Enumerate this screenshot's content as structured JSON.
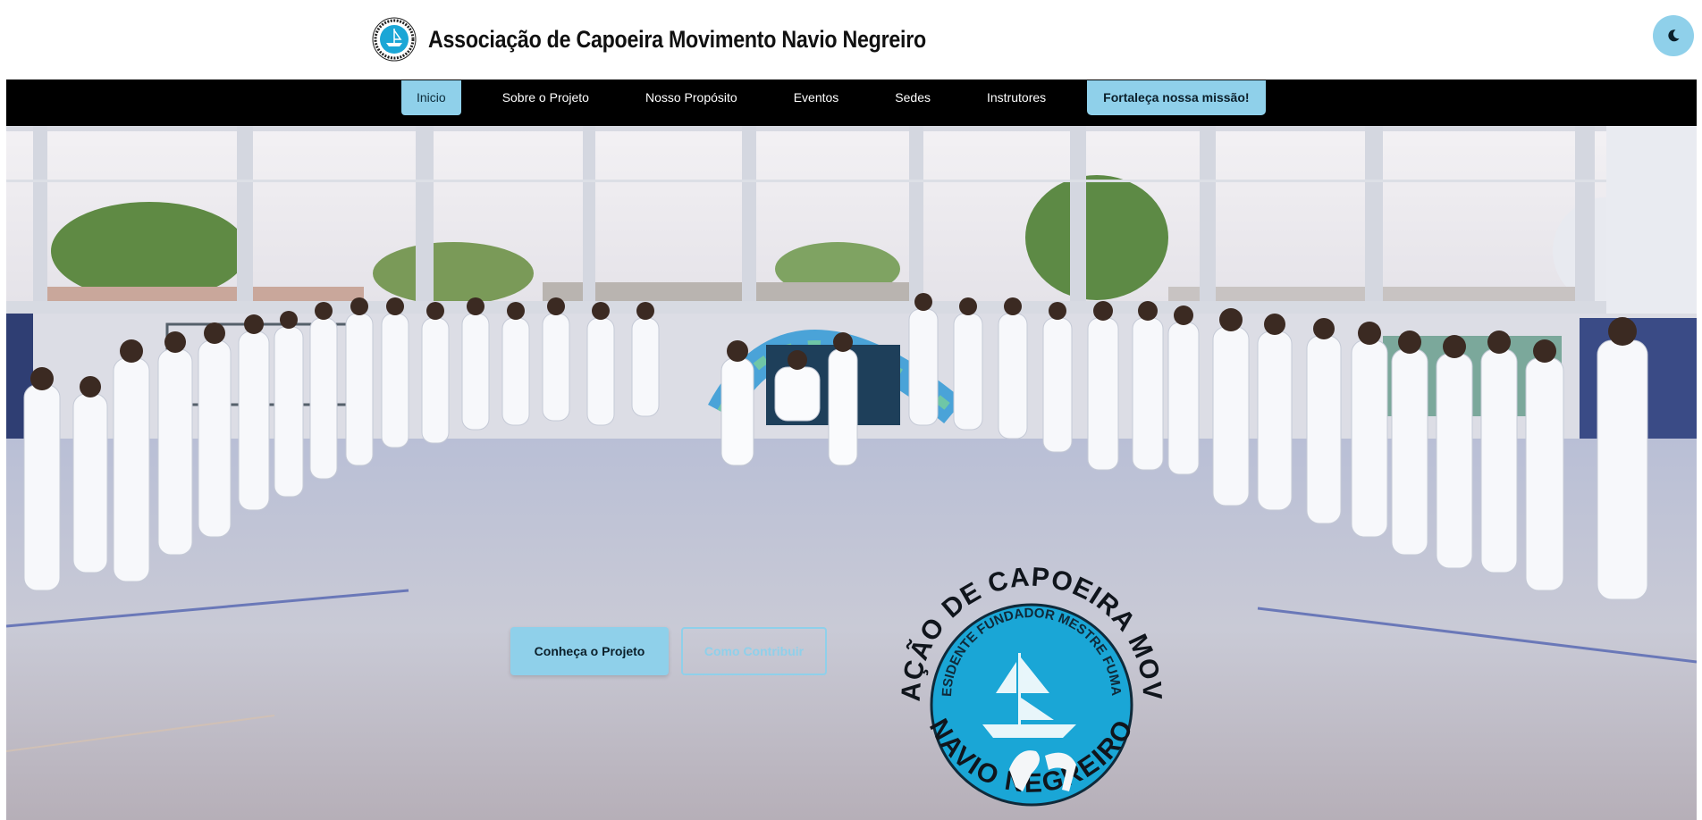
{
  "header": {
    "title": "Associação de Capoeira Movimento Navio Negreiro",
    "logo_icon": "association-logo",
    "theme_toggle_icon": "moon-icon"
  },
  "nav": {
    "items": [
      {
        "label": "Inicio",
        "active": true
      },
      {
        "label": "Sobre o Projeto"
      },
      {
        "label": "Nosso Propósito"
      },
      {
        "label": "Eventos"
      },
      {
        "label": "Sedes"
      },
      {
        "label": "Instrutores"
      }
    ],
    "cta_label": "Fortaleça nossa missão!"
  },
  "hero": {
    "primary_button": "Conheça o Projeto",
    "secondary_button": "Como Contribuir",
    "emblem": {
      "top_text": "ASSOCIAÇÃO DE CAPOEIRA MOVIMENTO",
      "inner_text": "PRESIDENTE FUNDADOR MESTRE FUMAÇA",
      "bottom_text": "NAVIO NEGREIRO"
    }
  },
  "colors": {
    "accent": "#8fd0ea",
    "nav_bg": "#000000",
    "emblem_blue": "#1aa6d6"
  }
}
